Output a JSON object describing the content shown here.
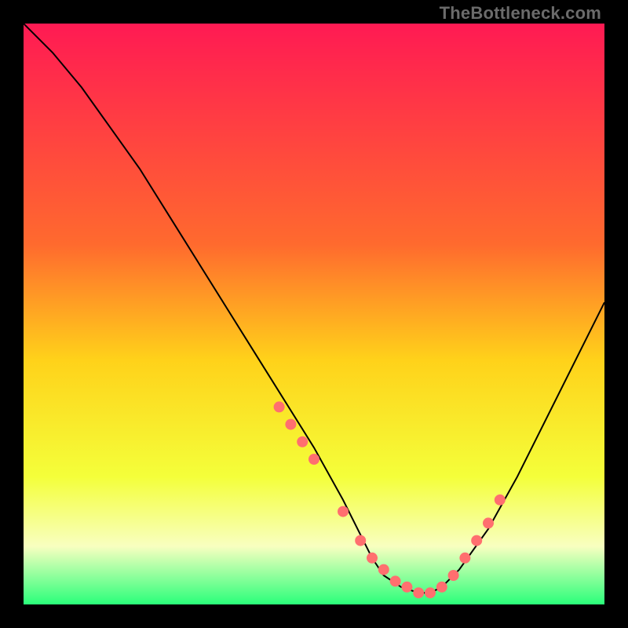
{
  "watermark": "TheBottleneck.com",
  "colors": {
    "top": "#ff1a53",
    "upper_mid": "#ff6a2e",
    "mid": "#ffd21a",
    "lower_mid": "#f4ff3a",
    "pale": "#f8ffc0",
    "green": "#2aff7a",
    "curve": "#000000",
    "marker": "#ff6f6f"
  },
  "chart_data": {
    "type": "line",
    "title": "",
    "xlabel": "",
    "ylabel": "",
    "xlim": [
      0,
      100
    ],
    "ylim": [
      0,
      100
    ],
    "series": [
      {
        "name": "curve",
        "x": [
          0,
          5,
          10,
          15,
          20,
          25,
          30,
          35,
          40,
          45,
          50,
          55,
          58,
          60,
          62,
          65,
          68,
          70,
          72,
          75,
          80,
          85,
          90,
          95,
          100
        ],
        "y": [
          100,
          95,
          89,
          82,
          75,
          67,
          59,
          51,
          43,
          35,
          27,
          18,
          12,
          8,
          5,
          3,
          2,
          2,
          3,
          6,
          13,
          22,
          32,
          42,
          52
        ]
      }
    ],
    "markers": {
      "name": "dots",
      "x": [
        44,
        46,
        48,
        50,
        55,
        58,
        60,
        62,
        64,
        66,
        68,
        70,
        72,
        74,
        76,
        78,
        80,
        82
      ],
      "y": [
        34,
        31,
        28,
        25,
        16,
        11,
        8,
        6,
        4,
        3,
        2,
        2,
        3,
        5,
        8,
        11,
        14,
        18
      ]
    },
    "gradient_stops": [
      {
        "pct": 0,
        "key": "top"
      },
      {
        "pct": 38,
        "key": "upper_mid"
      },
      {
        "pct": 58,
        "key": "mid"
      },
      {
        "pct": 78,
        "key": "lower_mid"
      },
      {
        "pct": 90,
        "key": "pale"
      },
      {
        "pct": 100,
        "key": "green"
      }
    ]
  }
}
